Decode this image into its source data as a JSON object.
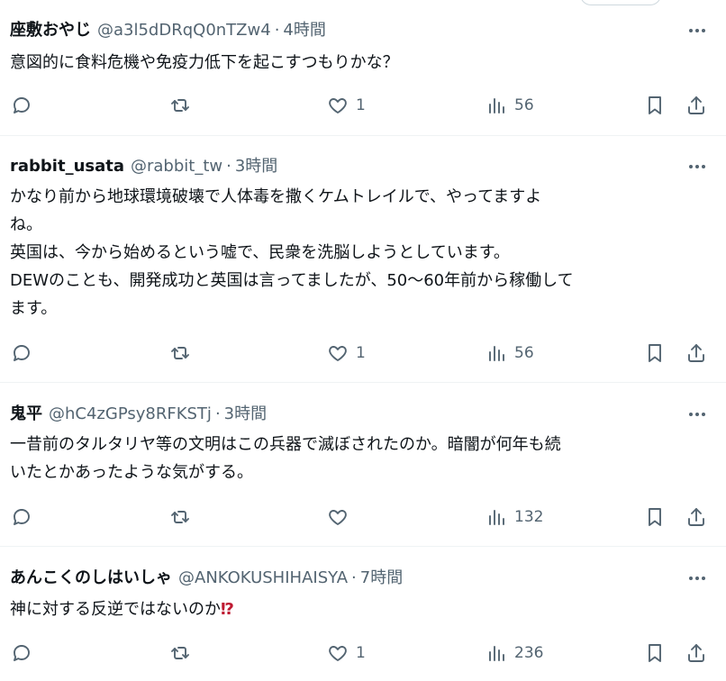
{
  "posts": [
    {
      "name": "座敷おやじ",
      "handle": "@a3l5dDRqQ0nTZw4",
      "dot": "·",
      "time": "4時間",
      "text": "意図的に食料危機や免疫力低下を起こすつもりかな？",
      "emoji": "",
      "likes": "1",
      "views": "56"
    },
    {
      "name": "rabbit_usata",
      "handle": "@rabbit_tw",
      "dot": "·",
      "time": "3時間",
      "text": "かなり前から地球環境破壊で人体毒を撒くケムトレイルで、やってますよ\nね。\n英国は、今から始めるという嘘で、民衆を洗脳しようとしています。\nDEWのことも、開発成功と英国は言ってましたが、50〜60年前から稼働して\nます。",
      "emoji": "",
      "likes": "1",
      "views": "56"
    },
    {
      "name": "鬼平",
      "handle": "@hC4zGPsy8RFKSTj",
      "dot": "·",
      "time": "3時間",
      "text": "一昔前のタルタリヤ等の文明はこの兵器で滅ぼされたのか。暗闇が何年も続\nいたとかあったような気がする。",
      "emoji": "",
      "likes": "",
      "views": "132"
    },
    {
      "name": "あんこくのしはいしゃ",
      "handle": "@ANKOKUSHIHAISYA",
      "dot": "·",
      "time": "7時間",
      "text": "神に対する反逆ではないのか",
      "emoji": "⁉",
      "likes": "1",
      "views": "236"
    }
  ],
  "icons": {
    "reply": "reply-icon",
    "repost": "repost-icon",
    "like": "heart-icon",
    "views": "views-chart-icon",
    "bookmark": "bookmark-icon",
    "share": "share-icon",
    "more": "more-dots-icon"
  },
  "colors": {
    "text": "#0f1419",
    "secondary": "#536471",
    "divider": "#eff3f4",
    "emoji_red": "#be1931"
  }
}
